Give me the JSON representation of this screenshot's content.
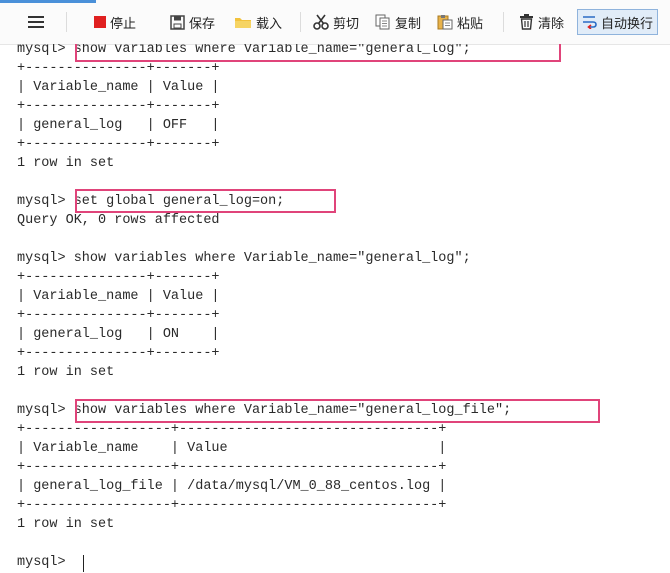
{
  "toolbar": {
    "menu_icon": "hamburger-icon",
    "stop_label": "停止",
    "save_label": "保存",
    "load_label": "载入",
    "cut_label": "剪切",
    "copy_label": "复制",
    "paste_label": "粘贴",
    "clear_label": "清除",
    "autowrap_label": "自动换行",
    "colors": {
      "stop": "#e02020",
      "folder": "#f2c23c",
      "accent": "#4a90d9"
    }
  },
  "terminal": {
    "lines": [
      "mysql> show variables where Variable_name=\"general_log\";",
      "+---------------+-------+",
      "| Variable_name | Value |",
      "+---------------+-------+",
      "| general_log   | OFF   |",
      "+---------------+-------+",
      "1 row in set",
      "",
      "mysql> set global general_log=on;",
      "Query OK, 0 rows affected",
      "",
      "mysql> show variables where Variable_name=\"general_log\";",
      "+---------------+-------+",
      "| Variable_name | Value |",
      "+---------------+-------+",
      "| general_log   | ON    |",
      "+---------------+-------+",
      "1 row in set",
      "",
      "mysql> show variables where Variable_name=\"general_log_file\";",
      "+------------------+--------------------------------+",
      "| Variable_name    | Value                          |",
      "+------------------+--------------------------------+",
      "| general_log_file | /data/mysql/VM_0_88_centos.log |",
      "+------------------+--------------------------------+",
      "1 row in set",
      "",
      "mysql> "
    ],
    "highlight_color": "#e0447a"
  }
}
